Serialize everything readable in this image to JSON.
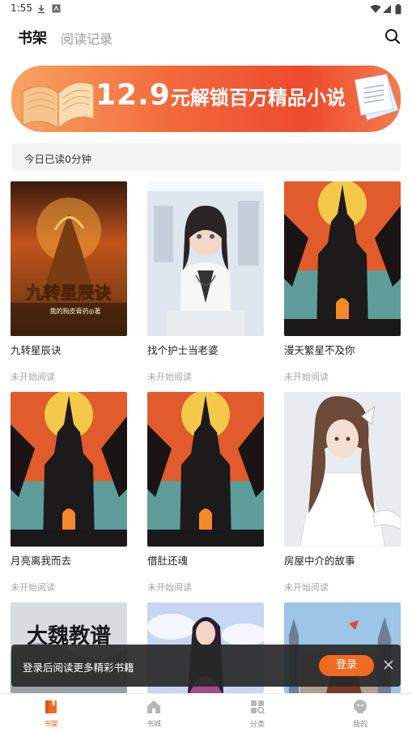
{
  "status_bar": {
    "time": "1:55"
  },
  "header": {
    "tab_shelf": "书架",
    "tab_history": "阅读记录"
  },
  "banner": {
    "price": "12.9",
    "description": "元解锁百万精品小说"
  },
  "reading": {
    "today": "今日已读0分钟"
  },
  "books": [
    {
      "title": "九转星辰诀",
      "status": "未开始阅读",
      "cover": "fantasy-cover",
      "cover_text": "九转星辰诀",
      "cover_author": "我的狗皮膏药◎著"
    },
    {
      "title": "找个护士当老婆",
      "status": "未开始阅读",
      "cover": "nurse-cover"
    },
    {
      "title": "漫天繁星不及你",
      "status": "未开始阅读",
      "cover": "castle-cover"
    },
    {
      "title": "月亮离我而去",
      "status": "未开始阅读",
      "cover": "castle-cover"
    },
    {
      "title": "借肚还魂",
      "status": "未开始阅读",
      "cover": "castle-cover"
    },
    {
      "title": "房屋中介的故事",
      "status": "未开始阅读",
      "cover": "girl-cover"
    },
    {
      "title": "",
      "status": "",
      "cover": "ink-cover",
      "cover_text": "大魏教谱"
    },
    {
      "title": "",
      "status": "",
      "cover": "woman-cover"
    },
    {
      "title": "",
      "status": "",
      "cover": "town-cover"
    }
  ],
  "login_prompt": {
    "message": "登录后阅读更多精彩书籍",
    "button": "登录"
  },
  "nav": {
    "shelf": "书架",
    "store": "书城",
    "category": "分类",
    "mine": "我的"
  },
  "colors": {
    "accent": "#f26a21",
    "banner_start": "#f8a364",
    "banner_end": "#ee4a2d"
  }
}
